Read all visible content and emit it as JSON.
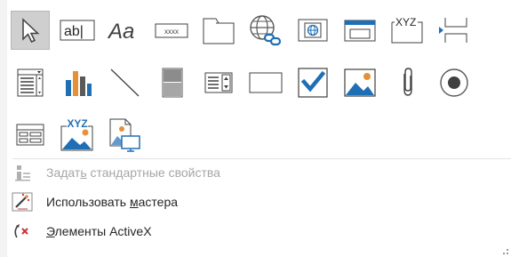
{
  "gallery": {
    "selected_tool": "select-pointer",
    "rows": [
      [
        "select-pointer",
        "textbox",
        "label",
        "button",
        "tab-control",
        "hyperlink",
        "web-browser",
        "navigation-control",
        "option-group",
        "page-break"
      ],
      [
        "combo-box",
        "chart",
        "line",
        "toggle-button",
        "list-box",
        "rectangle",
        "check-box",
        "unbound-object-frame",
        "attachment",
        "option-button"
      ],
      [
        "subform",
        "bound-object-frame",
        "image"
      ]
    ],
    "textbox_glyph": "ab|",
    "label_glyph": "Aa",
    "button_glyph": "xxxx",
    "option_group_glyph": "XYZ",
    "bound_frame_glyph": "XYZ"
  },
  "menu": {
    "set_defaults": {
      "pre": "Задат",
      "key": "ь",
      "post": " стандартные свойства",
      "enabled": false
    },
    "use_wizards": {
      "pre": "Использовать ",
      "key": "м",
      "post": "астера",
      "enabled": true
    },
    "activex": {
      "pre": "",
      "key": "Э",
      "post": "лементы ActiveX",
      "enabled": true
    }
  },
  "colors": {
    "accent_blue": "#1f6fb5",
    "icon_gray": "#595959",
    "selected_bg": "#cfcfcf",
    "chart_orange": "#e69138"
  }
}
